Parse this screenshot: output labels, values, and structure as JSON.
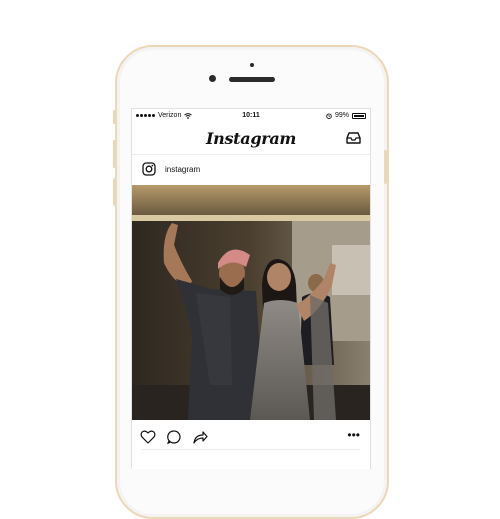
{
  "status_bar": {
    "carrier": "Verizon",
    "time": "10:11",
    "battery": "99%"
  },
  "app": {
    "logo_text": "Instagram"
  },
  "post": {
    "username": "instagram",
    "more_label": "•••",
    "photo_description_icon": "photo"
  },
  "icons": {
    "wifi": "wifi-icon",
    "alarm": "alarm-icon",
    "inbox": "inbox-icon",
    "avatar": "instagram-camera-icon",
    "like": "heart-icon",
    "comment": "comment-icon",
    "share": "share-icon"
  },
  "colors": {
    "phone_trim": "#ecd7b7",
    "text": "#111111"
  }
}
